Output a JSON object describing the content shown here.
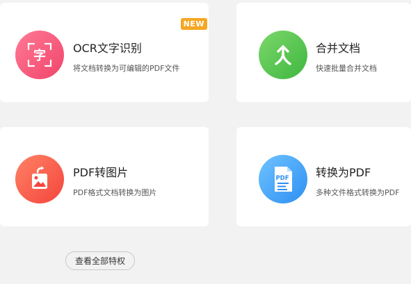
{
  "cards": [
    {
      "title": "OCR文字识别",
      "desc": "将文档转换为可编辑的PDF文件",
      "badge": "NEW",
      "icon": "ocr-icon"
    },
    {
      "title": "合并文档",
      "desc": "快速批量合并文档",
      "icon": "merge-icon"
    },
    {
      "title": "PDF转图片",
      "desc": "PDF格式文档转换为图片",
      "icon": "pdf-to-image-icon"
    },
    {
      "title": "转换为PDF",
      "desc": "多种文件格式转换为PDF",
      "icon": "convert-to-pdf-icon",
      "icon_text": "PDF"
    }
  ],
  "view_all_label": "查看全部特权",
  "ocr_icon_char": "字",
  "colors": {
    "ocr": "#f0446a",
    "merge": "#3fb640",
    "pdf_to_image": "#f4453c",
    "to_pdf": "#2e8ff2",
    "badge": "#f5a623"
  }
}
